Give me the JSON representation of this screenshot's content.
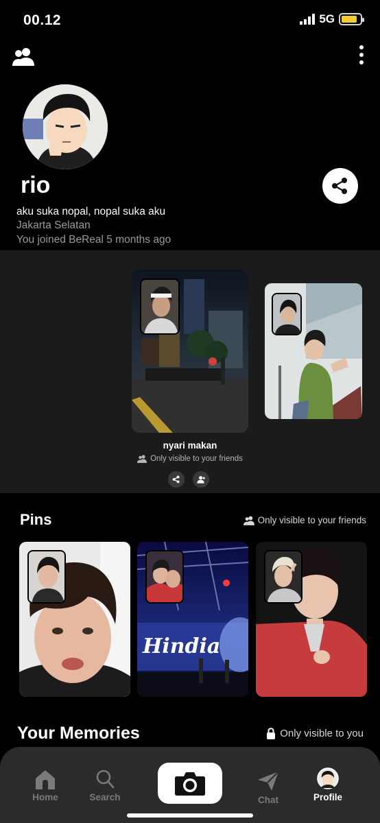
{
  "status_bar": {
    "time": "00.12",
    "network": "5G",
    "battery_level": 0.85,
    "battery_color": "#f4cc33"
  },
  "profile": {
    "username": "rio",
    "bio": "aku suka nopal, nopal suka aku",
    "location": "Jakarta Selatan",
    "joined": "You joined BeReal 5 months ago"
  },
  "post": {
    "caption": "nyari makan",
    "visibility": "Only visible to your friends"
  },
  "pins": {
    "title": "Pins",
    "visibility": "Only visible to your friends",
    "items": [
      {
        "overlay_text": ""
      },
      {
        "overlay_text": "Hindia"
      },
      {
        "overlay_text": ""
      }
    ]
  },
  "memories": {
    "title": "Your Memories",
    "visibility": "Only visible to you"
  },
  "tabbar": {
    "tabs": [
      {
        "label": "Home",
        "icon": "home-icon",
        "active": false
      },
      {
        "label": "Search",
        "icon": "search-icon",
        "active": false
      },
      {
        "label": "Chat",
        "icon": "send-icon",
        "active": false
      },
      {
        "label": "Profile",
        "icon": "avatar",
        "active": true
      }
    ]
  },
  "colors": {
    "background": "#000000",
    "band": "#1b1b1c",
    "tabbar": "#2b2b2d",
    "muted_text": "#9a9a9a"
  }
}
